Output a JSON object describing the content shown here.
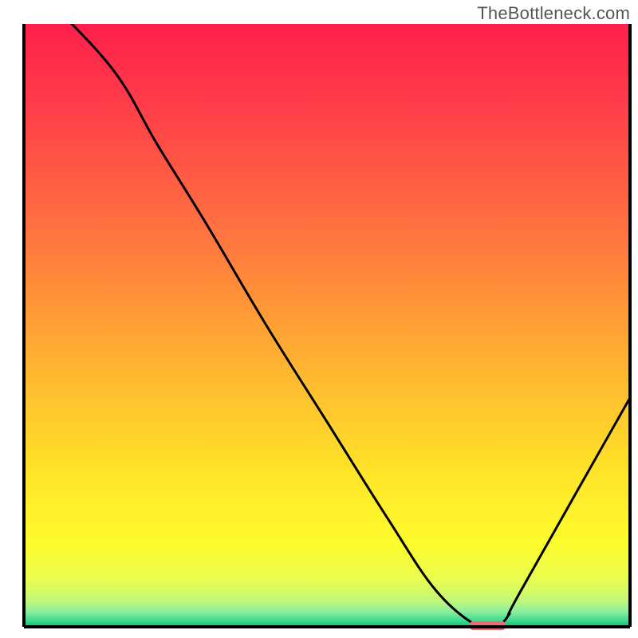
{
  "watermark": "TheBottleneck.com",
  "chart_data": {
    "type": "line",
    "title": "",
    "xlabel": "",
    "ylabel": "",
    "xlim": [
      0,
      100
    ],
    "ylim": [
      0,
      100
    ],
    "x": [
      0,
      5,
      15,
      22,
      30,
      40,
      50,
      60,
      68,
      75,
      78,
      80,
      82,
      100
    ],
    "values": [
      108,
      103,
      92,
      80,
      67,
      50,
      34,
      18,
      6,
      0,
      0,
      2,
      6,
      38
    ],
    "marker": {
      "x": 76.5,
      "y": 0.2,
      "w": 6,
      "h": 1.5,
      "color": "#ec6b77"
    },
    "gradient_stops": [
      {
        "offset": 0.0,
        "color": "#ff1f4b"
      },
      {
        "offset": 0.12,
        "color": "#ff3a4a"
      },
      {
        "offset": 0.25,
        "color": "#ff5a44"
      },
      {
        "offset": 0.38,
        "color": "#ff7d3e"
      },
      {
        "offset": 0.5,
        "color": "#ffa035"
      },
      {
        "offset": 0.62,
        "color": "#ffc22e"
      },
      {
        "offset": 0.74,
        "color": "#ffe328"
      },
      {
        "offset": 0.86,
        "color": "#fdfc2c"
      },
      {
        "offset": 0.92,
        "color": "#eafc4d"
      },
      {
        "offset": 0.955,
        "color": "#c5f877"
      },
      {
        "offset": 0.975,
        "color": "#8bee9e"
      },
      {
        "offset": 0.99,
        "color": "#3cd98e"
      },
      {
        "offset": 1.0,
        "color": "#06c171"
      }
    ],
    "axis_color": "#000000",
    "line_color": "#000000"
  }
}
